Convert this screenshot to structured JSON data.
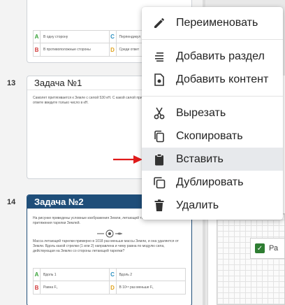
{
  "cards": {
    "prev": {
      "answers": [
        {
          "letter": "A",
          "text": "В одну сторону"
        },
        {
          "letter": "C",
          "text": "Перпендикул"
        },
        {
          "letter": "B",
          "text": "В противоположные стороны"
        },
        {
          "letter": "D",
          "text": "Среди ответ"
        }
      ]
    },
    "task1": {
      "number": "13",
      "title": "Задача №1",
      "text": "Самолет притягивается к Земле с силой 530 кН. С какой силой притягивается к самолету? В ответе введите только число в кН."
    },
    "task2": {
      "number": "14",
      "title": "Задача №2",
      "text1": "На рисунке приведены условные изображения Земли, летающей тарелки и вектора F₁ силы притяжения тарелки Землей.",
      "text2": "Масса летающей тарелки примерно в 1018 раз меньше массы Земли, и она удаляется от Земли. Вдоль какой стрелки (1 или 2) направлена и чему равна по модулю сила, действующая на Землю со стороны летающей тарелки?",
      "answers": [
        {
          "letter": "A",
          "text": "Вдоль 1"
        },
        {
          "letter": "C",
          "text": "Вдоль 2"
        },
        {
          "letter": "B",
          "text": "Равна F₁"
        },
        {
          "letter": "D",
          "text": "В 10¹⁸ раз меньше F₁"
        }
      ]
    }
  },
  "editor": {
    "answer_text": "Ра"
  },
  "menu": {
    "items": [
      {
        "label": "Переименовать",
        "icon": "pencil-icon"
      },
      {
        "label": "Добавить раздел",
        "icon": "lines-icon"
      },
      {
        "label": "Добавить контент",
        "icon": "document-icon"
      },
      {
        "label": "Вырезать",
        "icon": "scissors-icon"
      },
      {
        "label": "Скопировать",
        "icon": "copy-icon"
      },
      {
        "label": "Вставить",
        "icon": "clipboard-icon"
      },
      {
        "label": "Дублировать",
        "icon": "duplicate-icon"
      },
      {
        "label": "Удалить",
        "icon": "trash-icon"
      }
    ]
  },
  "colors": {
    "accent": "#1f4e79",
    "arrow": "#e01b1b",
    "highlight": "#e7e9ec"
  }
}
